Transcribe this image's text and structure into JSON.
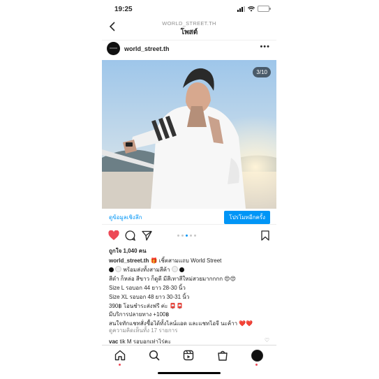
{
  "status": {
    "time": "19:25"
  },
  "header": {
    "back_icon": "chevron-left-icon",
    "account": "WORLD_STREET.TH",
    "title": "โพสต์"
  },
  "post": {
    "username": "world_street.th",
    "image_counter": "3/10",
    "insights_label": "ดูข้อมูลเชิงลึก",
    "boost_label": "โปรโมทอีกครั้ง",
    "carousel_dots": 5,
    "active_dot": 2,
    "likes": "ถูกใจ 1,040 คน",
    "caption": {
      "line1_user": "world_street.th",
      "line1_text": "เชิ้ตสามแถบ World Street",
      "line2": "พร้อมส่งทั้งสามสีค้า",
      "line3": "สีดำ ก็หล่อ สีขาว ก็ดูดี มีสีเทาสีใหม่สวยมากกกก",
      "line4": "Size L รอบอก 44 ยาว 28-30 นิ้ว",
      "line5": "Size XL รอบอก 48 ยาว 30-31 นิ้ว",
      "line6": "390฿ โอนชำระส่งฟรี ค่ะ",
      "line7": "มีบริการปลายทาง +100฿",
      "line8": "สนใจทักแชทสั่งซื้อได้ทั้งไลน์แอด และแชทไอจี นะค้าา"
    },
    "view_comments": "ดูความคิดเห็นทั้ง 17 รายการ",
    "comment": {
      "user": "vac",
      "text": "tik M รอบอกเท่าไร่คะ"
    }
  },
  "colors": {
    "accent": "#0095f6",
    "like_red": "#ed4956",
    "text": "#262626",
    "muted": "#8e8e8e"
  },
  "tabbar": {
    "items": [
      "home-icon",
      "search-icon",
      "reels-icon",
      "shop-icon",
      "profile-avatar"
    ]
  }
}
